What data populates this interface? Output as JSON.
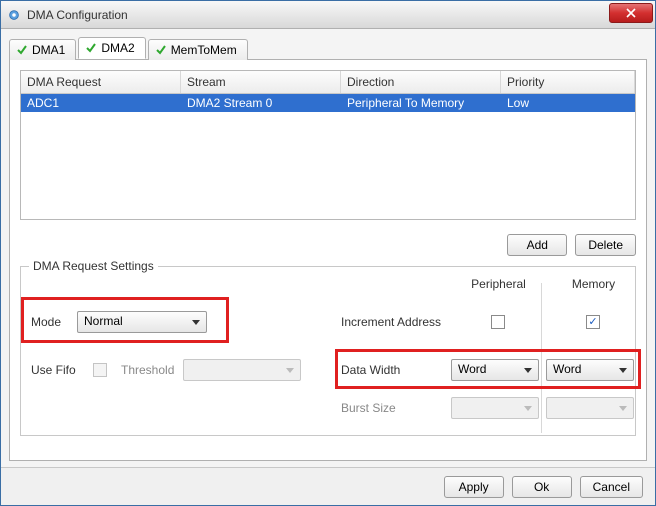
{
  "window": {
    "title": "DMA Configuration"
  },
  "tabs": [
    {
      "label": "DMA1"
    },
    {
      "label": "DMA2"
    },
    {
      "label": "MemToMem"
    }
  ],
  "activeTab": 1,
  "table": {
    "headers": [
      "DMA Request",
      "Stream",
      "Direction",
      "Priority"
    ],
    "rows": [
      {
        "request": "ADC1",
        "stream": "DMA2 Stream 0",
        "direction": "Peripheral To Memory",
        "priority": "Low"
      }
    ]
  },
  "buttons": {
    "add": "Add",
    "delete": "Delete",
    "apply": "Apply",
    "ok": "Ok",
    "cancel": "Cancel"
  },
  "group": {
    "legend": "DMA Request Settings",
    "col_peripheral": "Peripheral",
    "col_memory": "Memory",
    "mode_label": "Mode",
    "mode_value": "Normal",
    "increment_label": "Increment Address",
    "increment_peripheral_checked": false,
    "increment_memory_checked": true,
    "usefifo_label": "Use Fifo",
    "usefifo_checked": false,
    "threshold_label": "Threshold",
    "threshold_value": "",
    "datawidth_label": "Data Width",
    "datawidth_peripheral": "Word",
    "datawidth_memory": "Word",
    "burst_label": "Burst Size",
    "burst_peripheral": "",
    "burst_memory": ""
  },
  "colors": {
    "highlight": "#e02020",
    "selection": "#2f6fcf"
  }
}
